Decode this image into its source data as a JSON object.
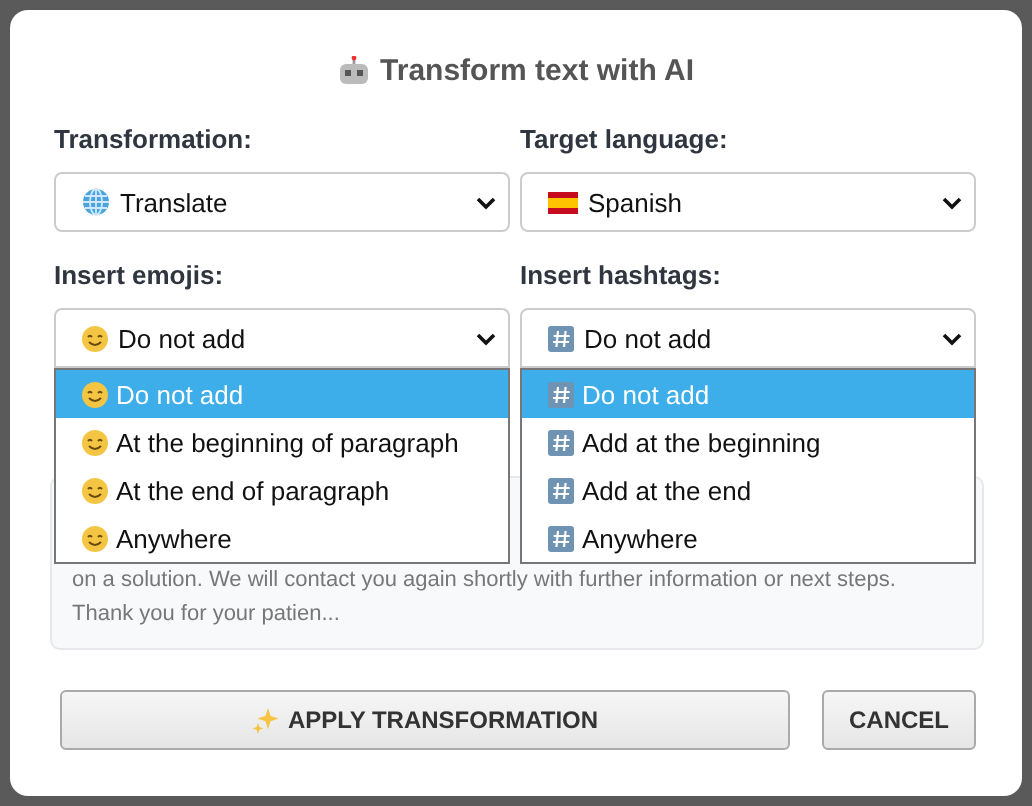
{
  "dialog": {
    "title": "Transform text with AI"
  },
  "fields": [
    {
      "label": "Transformation:",
      "value": "Translate",
      "expanded": false
    },
    {
      "label": "Target language:",
      "value": "Spanish",
      "expanded": false
    },
    {
      "label": "Insert emojis:",
      "value": "Do not add",
      "expanded": true,
      "options": [
        {
          "label": "Do not add",
          "selected": true
        },
        {
          "label": "At the beginning of paragraph",
          "selected": false
        },
        {
          "label": "At the end of paragraph",
          "selected": false
        },
        {
          "label": "Anywhere",
          "selected": false
        }
      ]
    },
    {
      "label": "Insert hashtags:",
      "value": "Do not add",
      "expanded": true,
      "options": [
        {
          "label": "Do not add",
          "selected": true
        },
        {
          "label": "Add at the beginning",
          "selected": false
        },
        {
          "label": "Add at the end",
          "selected": false
        },
        {
          "label": "Anywhere",
          "selected": false
        }
      ]
    }
  ],
  "preview": {
    "lines": [
      "on a solution. We will contact you again shortly with further information or next steps.",
      "Thank you for your patien..."
    ]
  },
  "buttons": [
    {
      "label": "APPLY TRANSFORMATION",
      "kind": "primary"
    },
    {
      "label": "CANCEL",
      "kind": "secondary"
    }
  ]
}
